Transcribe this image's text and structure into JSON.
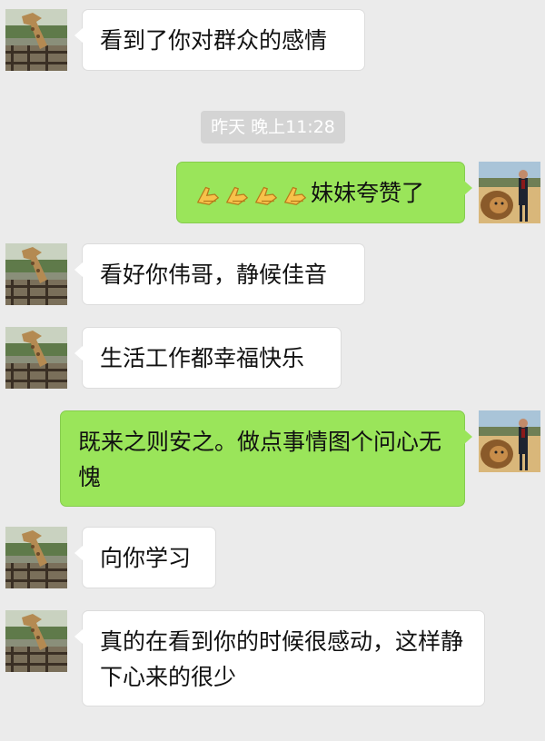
{
  "messages": [
    {
      "side": "left",
      "text": "看到了你对群众的感情"
    },
    {
      "side": "left",
      "text": "看好你伟哥，静候佳音"
    },
    {
      "side": "left",
      "text": "生活工作都幸福快乐"
    },
    {
      "side": "left",
      "text": "向你学习"
    },
    {
      "side": "left",
      "text": "真的在看到你的时候很感动，这样静下心来的很少"
    }
  ],
  "right_messages": [
    {
      "emoji": "pinched-fingers-icon",
      "emoji_count": 4,
      "text": "妹妹夸赞了"
    },
    {
      "text": "既来之则安之。做点事情图个问心无愧"
    }
  ],
  "timestamp": "昨天 晚上11:28",
  "colors": {
    "background": "#ebebeb",
    "bubble_left": "#ffffff",
    "bubble_right": "#9ae55a",
    "timestamp_bg": "#d4d4d4"
  },
  "avatars": {
    "left": "giraffe-avatar",
    "right": "man-with-lion-avatar"
  }
}
